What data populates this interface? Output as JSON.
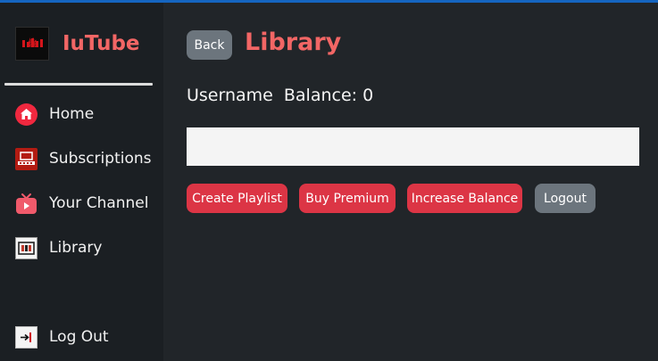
{
  "colors": {
    "accent": "#f26665",
    "danger": "#dc3545",
    "secondary": "#6c757d",
    "sidebar_bg": "#1b1f23",
    "main_bg": "#212529",
    "top_bar": "#1565c0"
  },
  "brand": {
    "title": "IuTube",
    "logo_icon": "iutube-logo-icon"
  },
  "sidebar": {
    "items": [
      {
        "label": "Home",
        "icon": "home-icon"
      },
      {
        "label": "Subscriptions",
        "icon": "subscriptions-icon"
      },
      {
        "label": "Your Channel",
        "icon": "tv-channel-icon"
      },
      {
        "label": "Library",
        "icon": "library-icon"
      }
    ],
    "logout": {
      "label": "Log Out",
      "icon": "logout-icon"
    }
  },
  "main": {
    "back_label": "Back",
    "title": "Library",
    "username": "Username",
    "balance_text": "Balance: 0",
    "input_value": "",
    "actions": {
      "create_playlist": "Create Playlist",
      "buy_premium": "Buy Premium",
      "increase_balance": "Increase Balance",
      "logout": "Logout"
    }
  }
}
